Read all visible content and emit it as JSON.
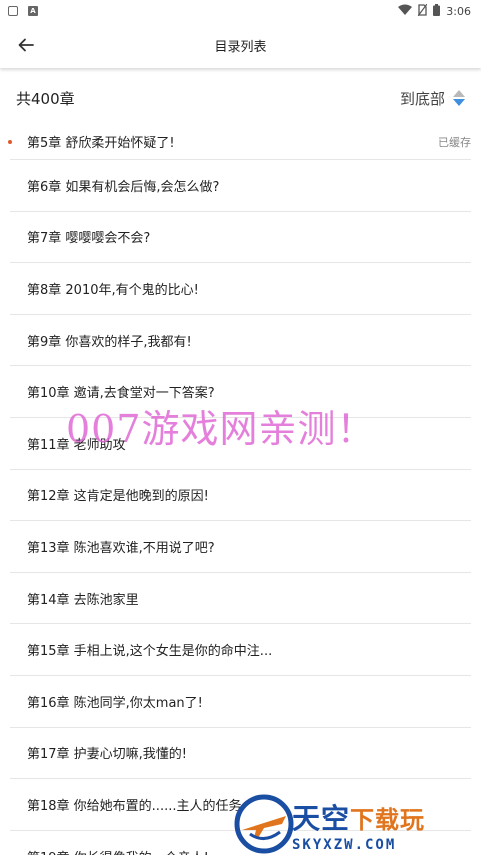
{
  "status": {
    "time": "3:06",
    "colors": {
      "icon": "#555555"
    }
  },
  "header": {
    "title": "目录列表",
    "back_icon": "arrow-left-icon"
  },
  "summary": {
    "total": "共400章",
    "to_bottom": "到底部"
  },
  "chapters": [
    {
      "label": "第5章 舒欣柔开始怀疑了!",
      "badge": "已缓存",
      "current": true
    },
    {
      "label": "第6章 如果有机会后悔,会怎么做?"
    },
    {
      "label": "第7章 嘤嘤嘤会不会?"
    },
    {
      "label": "第8章 2010年,有个鬼的比心!"
    },
    {
      "label": "第9章 你喜欢的样子,我都有!"
    },
    {
      "label": "第10章 邀请,去食堂对一下答案?"
    },
    {
      "label": "第11章 老师助攻"
    },
    {
      "label": "第12章 这肯定是他晚到的原因!"
    },
    {
      "label": "第13章 陈池喜欢谁,不用说了吧?"
    },
    {
      "label": "第14章 去陈池家里"
    },
    {
      "label": "第15章 手相上说,这个女生是你的命中注..."
    },
    {
      "label": "第16章 陈池同学,你太man了!"
    },
    {
      "label": "第17章 护妻心切嘛,我懂的!"
    },
    {
      "label": "第18章 你给她布置的......主人的任务"
    },
    {
      "label": "第19章 你长得像我的一个亲人!"
    }
  ],
  "watermark": "007游戏网亲测！",
  "logo": {
    "main": "天空",
    "sub": "下载玩",
    "url": "SKYXZW.COM"
  },
  "colors": {
    "dot": "#e0582e",
    "sort_up": "#b9b9b9",
    "sort_down": "#3d8fe0",
    "watermark": "#e06ad6",
    "logo_blue": "#1a4ea3",
    "logo_orange": "#e0751d"
  }
}
